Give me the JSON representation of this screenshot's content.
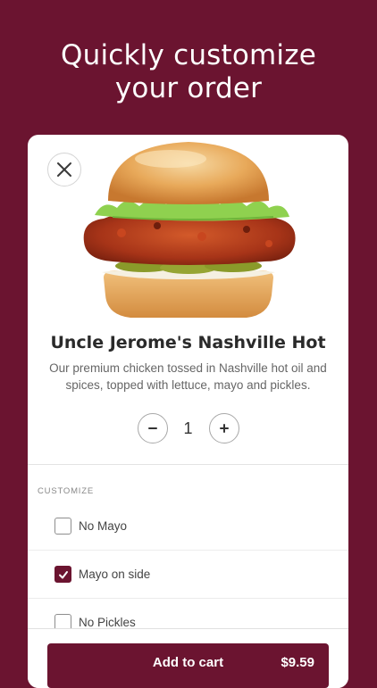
{
  "headline": {
    "line1": "Quickly customize",
    "line2": "your order"
  },
  "product": {
    "title": "Uncle Jerome's Nashville Hot",
    "description": "Our premium chicken tossed in Nashville hot oil and spices, topped with lettuce, mayo and pickles.",
    "image_icon": "nashville-hot-sandwich-image"
  },
  "quantity": {
    "decrement_label": "-",
    "value": "1",
    "increment_label": "+"
  },
  "customize": {
    "section_label": "CUSTOMIZE",
    "options": [
      {
        "label": "No Mayo",
        "checked": false
      },
      {
        "label": "Mayo on side",
        "checked": true
      },
      {
        "label": "No Pickles",
        "checked": false
      }
    ]
  },
  "cart": {
    "add_label": "Add to cart",
    "price": "$9.59"
  },
  "colors": {
    "brand": "#6b1430",
    "background": "#6b1430",
    "card": "#ffffff"
  }
}
